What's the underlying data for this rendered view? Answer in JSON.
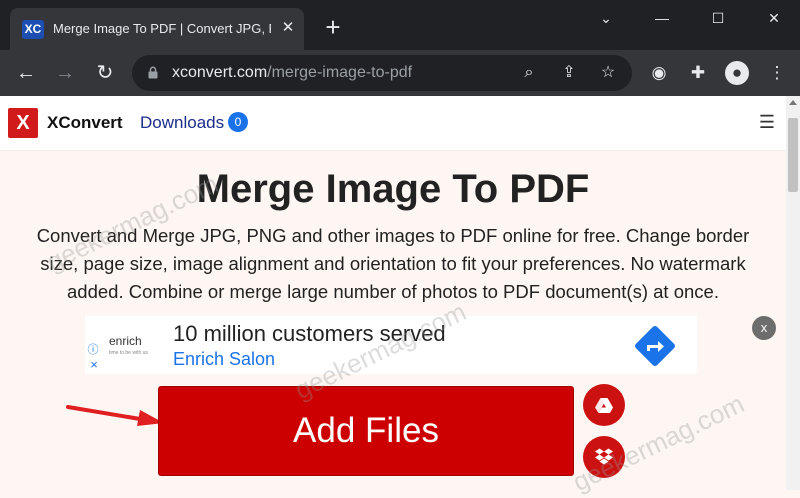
{
  "browser": {
    "tab_favicon": "XC",
    "tab_title": "Merge Image To PDF | Convert JPG, PNG",
    "tab_close": "✕",
    "new_tab": "+",
    "url_domain": "xconvert.com",
    "url_path": "/merge-image-to-pdf",
    "window_controls": [
      "⌄",
      "—",
      "☐",
      "✕"
    ]
  },
  "site": {
    "logo_mark": "X",
    "logo_text": "XConvert",
    "downloads_label": "Downloads",
    "downloads_count": "0",
    "menu_icon": "☰"
  },
  "main": {
    "headline": "Merge Image To PDF",
    "description": "Convert and Merge JPG, PNG and other images to PDF online for free. Change border size, page size, image alignment and orientation to fit your preferences. No watermark added. Combine or merge large number of photos to PDF document(s) at once.",
    "add_files_label": "Add Files",
    "close_ad_label": "x"
  },
  "ad": {
    "logo": "enrich",
    "logo_sub": "time to be with us",
    "title": "10 million customers served",
    "subtitle": "Enrich Salon"
  },
  "watermark": "geekermag.com",
  "colors": {
    "brand_red": "#cc0000",
    "link_blue": "#1b2d8a",
    "badge_blue": "#1a73e8",
    "chrome_dark": "#202124"
  }
}
